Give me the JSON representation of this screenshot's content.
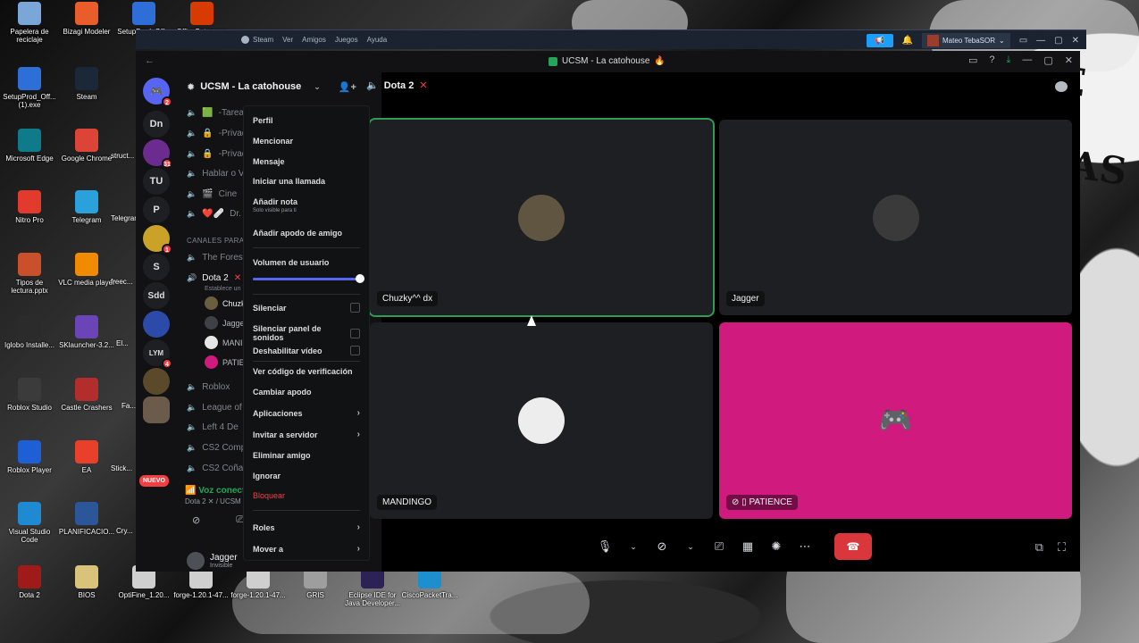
{
  "desktop": {
    "icons": [
      {
        "label": "Papelera de reciclaje",
        "color": "#7aa7d8"
      },
      {
        "label": "Bizagi Modeler",
        "color": "#e85d2a"
      },
      {
        "label": "SetupProd_Off...",
        "color": "#2d6fd6"
      },
      {
        "label": "OfficeSetup.exe",
        "color": "#d83b01"
      },
      {
        "label": "SetupProd_Off... (1).exe",
        "color": "#2d6fd6"
      },
      {
        "label": "Steam",
        "color": "#1b2838"
      },
      {
        "label": "Microsoft Edge",
        "color": "#0f7b8a"
      },
      {
        "label": "Google Chrome",
        "color": "#db4437"
      },
      {
        "label": "Nitro Pro",
        "color": "#e23b2d"
      },
      {
        "label": "Telegram",
        "color": "#2aa1da"
      },
      {
        "label": "Tipos de lectura.pptx",
        "color": "#c9502a"
      },
      {
        "label": "VLC media player",
        "color": "#f08a00"
      },
      {
        "label": "Iglobo Installe...",
        "color": "#2b2b2b"
      },
      {
        "label": "SKlauncher-3.2...",
        "color": "#6b45b8"
      },
      {
        "label": "Roblox Studio",
        "color": "#3b3b3b"
      },
      {
        "label": "Castle Crashers",
        "color": "#b32d2d"
      },
      {
        "label": "Roblox Player",
        "color": "#1f5fd6"
      },
      {
        "label": "EA",
        "color": "#e8402a"
      },
      {
        "label": "Visual Studio Code",
        "color": "#1f8ad2"
      },
      {
        "label": "PLANIFICACIO...",
        "color": "#2b579a"
      },
      {
        "label": "Dota 2",
        "color": "#a11a1a"
      },
      {
        "label": "BIOS",
        "color": "#d9c27a"
      },
      {
        "label": "OptiFine_1.20...",
        "color": "#cfcfcf"
      },
      {
        "label": "forge-1.20.1-47...",
        "color": "#cfcfcf"
      },
      {
        "label": "forge-1.20.1-47...",
        "color": "#cfcfcf"
      },
      {
        "label": "GRIS",
        "color": "#9e9e9e"
      },
      {
        "label": "Eclipse IDE for Java Developer...",
        "color": "#2c2255"
      },
      {
        "label": "CiscoPacketTra...",
        "color": "#1d8fcf"
      }
    ],
    "partial_labels": [
      "Telegram y Red...",
      "struct...",
      "freec...",
      "El...",
      "Fa...",
      "Stick...",
      "Cry..."
    ]
  },
  "steam": {
    "menu": [
      "Steam",
      "Ver",
      "Amigos",
      "Juegos",
      "Ayuda"
    ],
    "user_name": "Mateo TebaSOR",
    "chevron": "⌄",
    "window_controls": [
      "▭",
      "—",
      "▢",
      "✕"
    ]
  },
  "discord": {
    "window_title": "UCSM - La catohouse",
    "title_emoji": "🔥",
    "server_name": "UCSM - La catohouse",
    "call_channel": "Dota 2",
    "rail": [
      {
        "label": "Dn"
      },
      {
        "label": "31",
        "badge": "31"
      },
      {
        "label": "TU"
      },
      {
        "label": "P"
      },
      {
        "label": "",
        "badge": "1"
      },
      {
        "label": "S"
      },
      {
        "label": "Sdd"
      },
      {
        "label": ""
      },
      {
        "label": "LYM",
        "badge": "4"
      },
      {
        "label": ""
      },
      {
        "label": ""
      }
    ],
    "dm_badge": "2",
    "nuevo_label": "NUEVO",
    "channels": [
      {
        "name": "-Tarea",
        "emoji": "🟩"
      },
      {
        "name": "-Privad",
        "emoji": "🔒"
      },
      {
        "name": "-Privad",
        "emoji": "🔒"
      },
      {
        "name": "Hablar o V",
        "emoji": ""
      },
      {
        "name": "Cine",
        "emoji": "🎬"
      },
      {
        "name": "Dr.",
        "emoji": "❤️🩹"
      }
    ],
    "category": "CANALES PARA",
    "voice_channels": [
      {
        "name": "The Fores"
      },
      {
        "name": "Dota 2",
        "status": "Establece un",
        "active": true
      }
    ],
    "members": [
      "Chuzk",
      "Jagge",
      "MANI",
      "PATIE"
    ],
    "more_channels": [
      "Roblox",
      "League of",
      "Left 4 De",
      "CS2 Comp",
      "CS2 Coña"
    ],
    "voice_status": "Voz conectada",
    "voice_sub": "Dota 2 ✕ / UCSM - La",
    "user_name": "Jagger",
    "user_status": "Invisible",
    "tiles": [
      {
        "name": "Chuzky^^ dx",
        "speaking": true
      },
      {
        "name": "Jagger",
        "speaking": false
      },
      {
        "name": "MANDINGO",
        "speaking": false
      },
      {
        "name": "PATIENCE",
        "speaking": false,
        "color": "#d01a7e"
      }
    ],
    "context_menu": {
      "items": [
        {
          "label": "Perfil"
        },
        {
          "label": "Mencionar"
        },
        {
          "label": "Mensaje"
        },
        {
          "label": "Iniciar una llamada"
        },
        {
          "label": "Añadir nota",
          "sub": "Solo visible para ti"
        },
        {
          "label": "Añadir apodo de amigo"
        }
      ],
      "volume_label": "Volumen de usuario",
      "volume_fraction": 1.0,
      "checkbox_items": [
        "Silenciar",
        "Silenciar panel de sonidos",
        "Deshabilitar vídeo"
      ],
      "plain_items": [
        "Ver código de verificación",
        "Cambiar apodo"
      ],
      "arrow_items": [
        "Aplicaciones",
        "Invitar a servidor"
      ],
      "tail_items": [
        "Eliminar amigo",
        "Ignorar"
      ],
      "danger_item": "Bloquear",
      "bottom_arrow_items": [
        "Roles",
        "Mover a"
      ]
    },
    "accent_colors": {
      "speaking": "#2f9c53",
      "danger": "#f23f43",
      "hangup": "#da373c",
      "slider": "#5865f2"
    }
  }
}
